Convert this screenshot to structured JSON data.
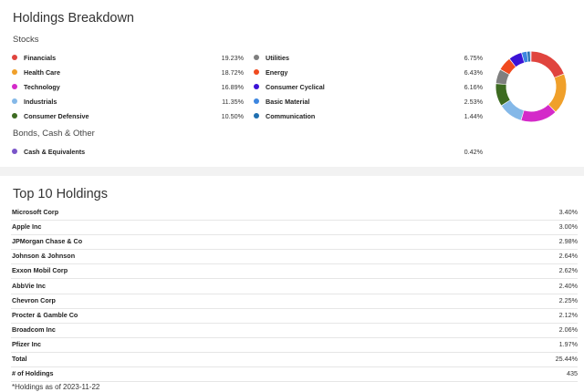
{
  "breakdown": {
    "title": "Holdings Breakdown",
    "stocks_label": "Stocks",
    "bonds_label": "Bonds, Cash & Other",
    "sectors": [
      {
        "label": "Financials",
        "pct": "19.23%",
        "value": 19.23,
        "color": "#e0443e",
        "icon": "dot"
      },
      {
        "label": "Health Care",
        "pct": "18.72%",
        "value": 18.72,
        "color": "#f0a02a",
        "icon": "dot"
      },
      {
        "label": "Technology",
        "pct": "16.89%",
        "value": 16.89,
        "color": "#d42ac9",
        "icon": "dot"
      },
      {
        "label": "Industrials",
        "pct": "11.35%",
        "value": 11.35,
        "color": "#84b8e8",
        "icon": "dot"
      },
      {
        "label": "Consumer Defensive",
        "pct": "10.50%",
        "value": 10.5,
        "color": "#3d6b21",
        "icon": "dot"
      },
      {
        "label": "Utilities",
        "pct": "6.75%",
        "value": 6.75,
        "color": "#7f7f7f",
        "icon": "dot"
      },
      {
        "label": "Energy",
        "pct": "6.43%",
        "value": 6.43,
        "color": "#f04a1f",
        "icon": "dot"
      },
      {
        "label": "Consumer Cyclical",
        "pct": "6.16%",
        "value": 6.16,
        "color": "#3b12d6",
        "icon": "dot"
      },
      {
        "label": "Basic Material",
        "pct": "2.53%",
        "value": 2.53,
        "color": "#3d86e0",
        "icon": "dot"
      },
      {
        "label": "Communication",
        "pct": "1.44%",
        "value": 1.44,
        "color": "#1f6fb0",
        "icon": "dot"
      }
    ],
    "other": [
      {
        "label": "Cash & Equivalents",
        "pct": "0.42%",
        "value": 0.42,
        "color": "#7a55c9",
        "icon": "dot"
      }
    ]
  },
  "top10": {
    "title": "Top 10 Holdings",
    "rows": [
      {
        "name": "Microsoft Corp",
        "value": "3.40%"
      },
      {
        "name": "Apple Inc",
        "value": "3.00%"
      },
      {
        "name": "JPMorgan Chase & Co",
        "value": "2.98%"
      },
      {
        "name": "Johnson & Johnson",
        "value": "2.64%"
      },
      {
        "name": "Exxon Mobil Corp",
        "value": "2.62%"
      },
      {
        "name": "AbbVie Inc",
        "value": "2.40%"
      },
      {
        "name": "Chevron Corp",
        "value": "2.25%"
      },
      {
        "name": "Procter & Gamble Co",
        "value": "2.12%"
      },
      {
        "name": "Broadcom Inc",
        "value": "2.06%"
      },
      {
        "name": "Pfizer Inc",
        "value": "1.97%"
      },
      {
        "name": "Total",
        "value": "25.44%"
      },
      {
        "name": "# of Holdings",
        "value": "435"
      }
    ],
    "footnote": "*Holdings as of 2023-11-22"
  }
}
